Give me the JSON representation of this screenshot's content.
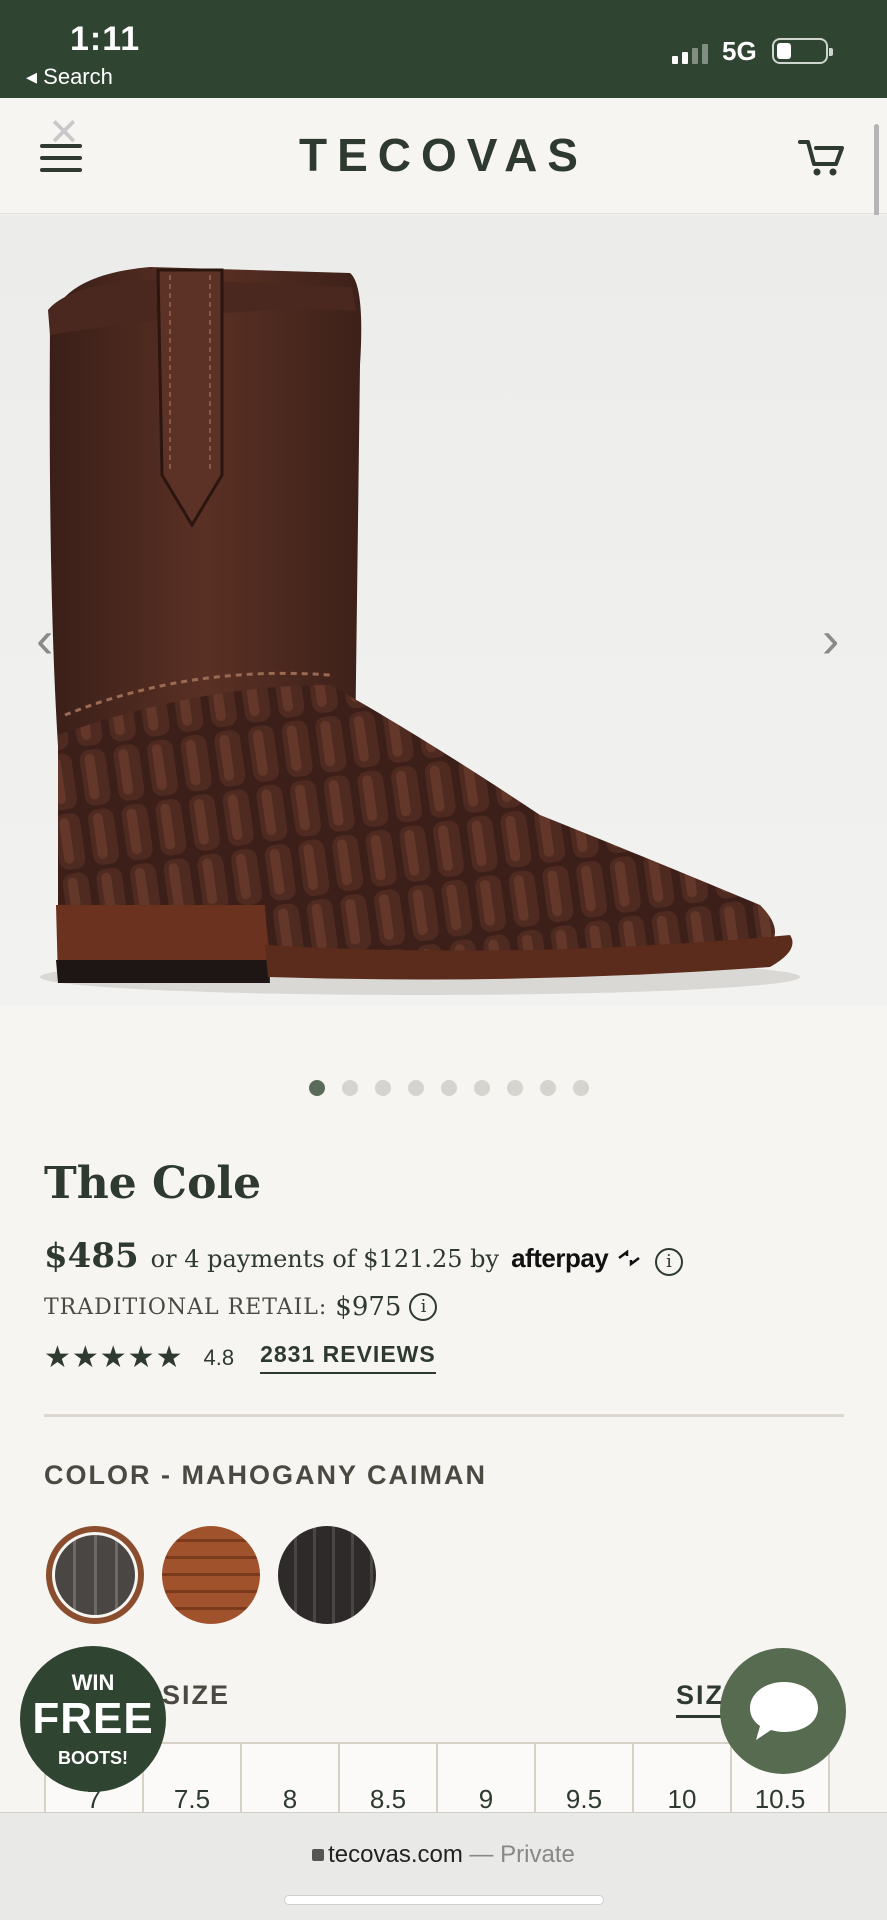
{
  "status_bar": {
    "time": "1:11",
    "back_label": "◂ Search",
    "network": "5G"
  },
  "header": {
    "brand": "TECOVAS"
  },
  "gallery": {
    "dot_count": 9,
    "active_index": 0
  },
  "product": {
    "name": "The Cole",
    "price": "$485",
    "installments": "or 4 payments of $121.25 by",
    "afterpay": "afterpay",
    "retail_label": "TRADITIONAL RETAIL:",
    "retail_value": "$975",
    "stars": "★★★★★",
    "rating": "4.8",
    "reviews_link": "2831 REVIEWS"
  },
  "color": {
    "label": "COLOR - MAHOGANY CAIMAN",
    "swatches": [
      "Mahogany Caiman",
      "Cognac Caiman",
      "Black Caiman"
    ]
  },
  "size": {
    "label": "SIZE",
    "guide_label": "SIZE GUIDE",
    "options": [
      "7",
      "7.5",
      "8",
      "8.5",
      "9",
      "9.5",
      "10",
      "10.5"
    ]
  },
  "promo_badge": {
    "win": "WIN",
    "free": "FREE",
    "boots": "BOOTS!"
  },
  "browser": {
    "domain": "tecovas.com",
    "separator": "—",
    "mode": "Private"
  },
  "colors": {
    "brand_green": "#2f4431",
    "chat_green": "#566b4f",
    "text_dark": "#2e3a30"
  }
}
